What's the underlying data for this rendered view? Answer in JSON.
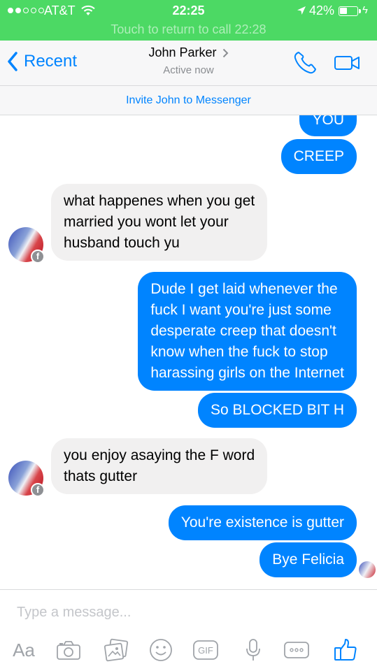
{
  "status_bar": {
    "carrier": "AT&T",
    "time": "22:25",
    "battery": "42%",
    "battery_level": 0.42,
    "call_banner": "Touch to return to call  22:28"
  },
  "header": {
    "back_label": "Recent",
    "contact_name": "John Parker",
    "active_status": "Active now",
    "invite_text": "Invite John to Messenger"
  },
  "messages": [
    {
      "sender": "me",
      "text": "YOU"
    },
    {
      "sender": "me",
      "text": "CREEP"
    },
    {
      "sender": "contact",
      "text": [
        "what happenes when you get",
        "married you wont let your",
        "husband touch yu"
      ]
    },
    {
      "sender": "me",
      "text": [
        "Dude I get laid whenever the",
        "fuck I want you're just some",
        "desperate creep that doesn't",
        "know when the fuck to stop",
        "harassing girls on the Internet"
      ]
    },
    {
      "sender": "me",
      "text": "So BLOCKED BIT H"
    },
    {
      "sender": "contact",
      "text": [
        "you enjoy asaying the F  word",
        "thats gutter"
      ]
    },
    {
      "sender": "me",
      "text": "You're existence is gutter"
    },
    {
      "sender": "me",
      "text": "Bye Felicia"
    }
  ],
  "composer": {
    "placeholder": "Type a message...",
    "text_label": "Aa",
    "gif_label": "GIF"
  },
  "icons": {
    "back": "chevron-left-icon",
    "call": "phone-icon",
    "video": "video-camera-icon",
    "camera": "camera-icon",
    "gallery": "photo-gallery-icon",
    "emoji": "smiley-icon",
    "gif": "gif-icon",
    "mic": "microphone-icon",
    "more": "more-icon",
    "like": "thumbs-up-icon"
  },
  "colors": {
    "call_banner": "#4cd964",
    "accent": "#0084ff",
    "incoming_bubble": "#f1f0f0",
    "toolbar_icon": "#a0a4a9"
  }
}
